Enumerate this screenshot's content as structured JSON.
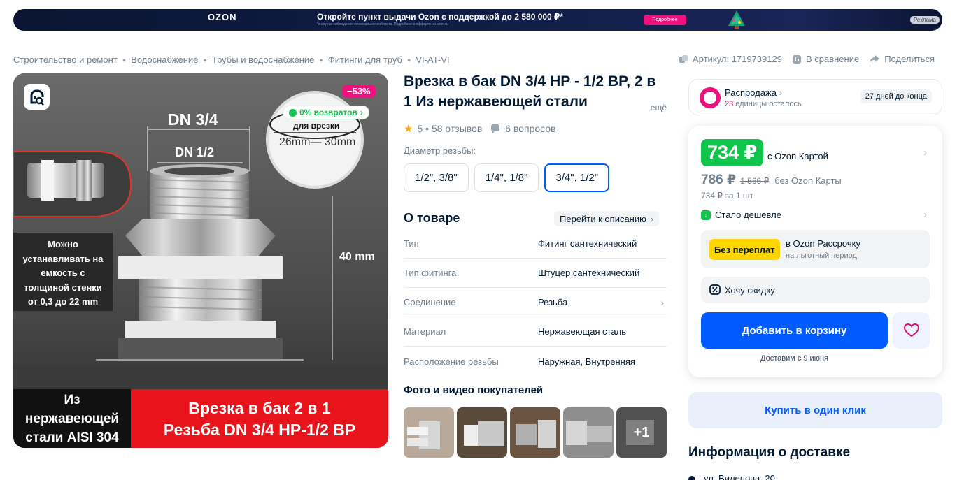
{
  "banner": {
    "logo": "OZON",
    "promo": "Откройте пункт выдачи Ozon с поддержкой до 2 580 000 ₽*",
    "promo_fine": "*в случае соблюдения минимального оборота. Подробнее в офферте на ozon.ru",
    "button": "Подробнее",
    "ad_label": "Реклама"
  },
  "breadcrumbs": [
    "Строительство и ремонт",
    "Водоснабжение",
    "Трубы и водоснабжение",
    "Фитинги для труб",
    "VI-AT-VI"
  ],
  "top_actions": {
    "article": "Артикул: 1719739129",
    "compare": "В сравнение",
    "share": "Поделиться"
  },
  "gallery": {
    "discount_badge": "−53%",
    "returns_badge": "0% возвратов",
    "dn_big": "DN 3/4",
    "dn_small": "DN 1/2",
    "hole_label": "для врезки",
    "hole_size": "26mm— 30mm",
    "height_label": "40 mm",
    "side_note": [
      "Можно",
      "устанавливать на",
      "емкость с",
      "толщиной стенки",
      "от 0,3 до 22 mm"
    ],
    "bottom_left": [
      "Из",
      "нержавеющей",
      "стали AISI 304"
    ],
    "bottom_right": [
      "Врезка в бак 2 в 1",
      "Резьба DN  3/4 НР-1/2 ВР"
    ]
  },
  "product": {
    "title": "Врезка в бак DN 3/4 НР - 1/2 ВР, 2 в 1 Из нержавеющей стали",
    "title_more": "ещё",
    "rating": "5",
    "reviews": "58 отзывов",
    "questions": "6 вопросов",
    "thread_label": "Диаметр резьбы:",
    "variants": [
      "1/2\", 3/8\"",
      "1/4\", 1/8\"",
      "3/4\", 1/2\""
    ],
    "active_variant": 2
  },
  "about": {
    "title": "О товаре",
    "goto": "Перейти к описанию",
    "specs": [
      {
        "k": "Тип",
        "v": "Фитинг сантехнический"
      },
      {
        "k": "Тип фитинга",
        "v": "Штуцер сантехнический"
      },
      {
        "k": "Соединение",
        "v": "Резьба"
      },
      {
        "k": "Материал",
        "v": "Нержавеющая сталь"
      },
      {
        "k": "Расположение резьбы",
        "v": "Наружная, Внутренняя"
      }
    ]
  },
  "photos": {
    "title": "Фото и видео покупателей",
    "more": "+1"
  },
  "sale": {
    "title": "Распродажа",
    "count": "23",
    "count_suffix": " единицы осталось",
    "days": "27 дней до конца"
  },
  "price": {
    "card_price": "734 ₽",
    "card_label": "с Ozon Картой",
    "price": "786 ₽",
    "old_price": "1 566 ₽",
    "no_card_label": "без Ozon Карты",
    "per_unit": "734 ₽ за 1 шт",
    "cheaper": "Стало дешевле",
    "installment_badge": "Без переплат",
    "installment_l1": "в Ozon Рассрочку",
    "installment_l2": "на льготный период",
    "discount": "Хочу скидку",
    "add_to_cart": "Добавить в корзину",
    "delivery": "Доставим с 9 июня"
  },
  "one_click": "Купить в один клик",
  "delivery_info": {
    "title": "Информация о доставке",
    "address": "ул. Виленова, 20"
  },
  "colors": {
    "accent": "#005bff",
    "price_green": "#10c44c",
    "sale_pink": "#f1117e",
    "installment_yellow": "#ffd600"
  }
}
